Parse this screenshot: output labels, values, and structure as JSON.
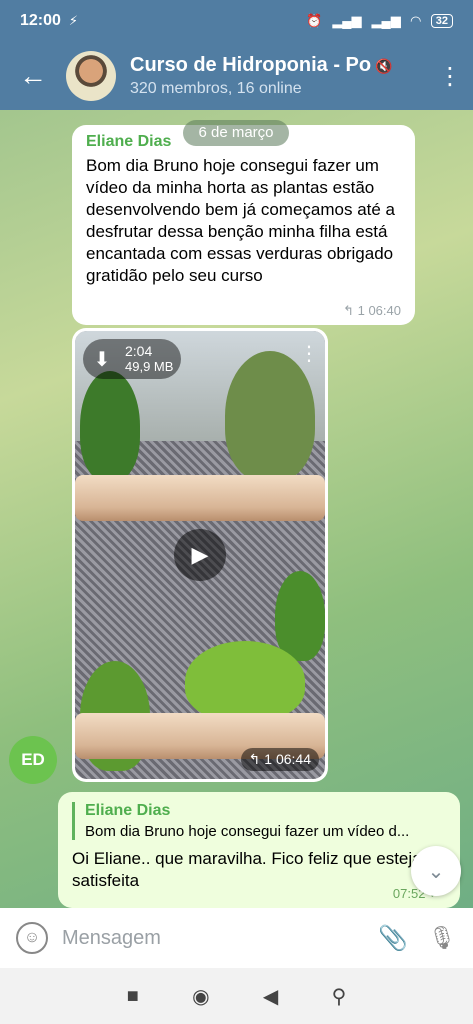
{
  "status_bar": {
    "time": "12:00",
    "battery": "32"
  },
  "header": {
    "title": "Curso de Hidroponia - Po",
    "subtitle": "320 membros, 16 online"
  },
  "chat": {
    "date": "6 de março",
    "message1": {
      "sender": "Eliane Dias",
      "text": "Bom dia Bruno hoje consegui fazer um vídeo da minha horta as plantas estão desenvolvendo bem já começamos até a desfrutar dessa benção minha filha está encantada com essas verduras obrigado gratidão pelo seu curso",
      "replies": "1",
      "time": "06:40"
    },
    "video": {
      "duration": "2:04",
      "size": "49,9 MB",
      "replies": "1",
      "time": "06:44"
    },
    "sender_avatar_initials": "ED",
    "outgoing": {
      "reply_to_name": "Eliane Dias",
      "reply_to_text": "Bom dia Bruno hoje consegui fazer um vídeo d...",
      "text": "Oi Eliane.. que maravilha. Fico feliz que esteja satisfeita",
      "time": "07:52"
    }
  },
  "input": {
    "placeholder": "Mensagem"
  },
  "icons": {
    "back": "arrow-left-icon",
    "more": "more-vertical-icon",
    "mute": "muted-icon",
    "download": "download-icon",
    "play": "play-icon",
    "reply": "reply-icon",
    "emoji": "emoji-icon",
    "attach": "paperclip-icon",
    "mic": "microphone-icon",
    "scroll_down": "chevron-down-icon"
  }
}
